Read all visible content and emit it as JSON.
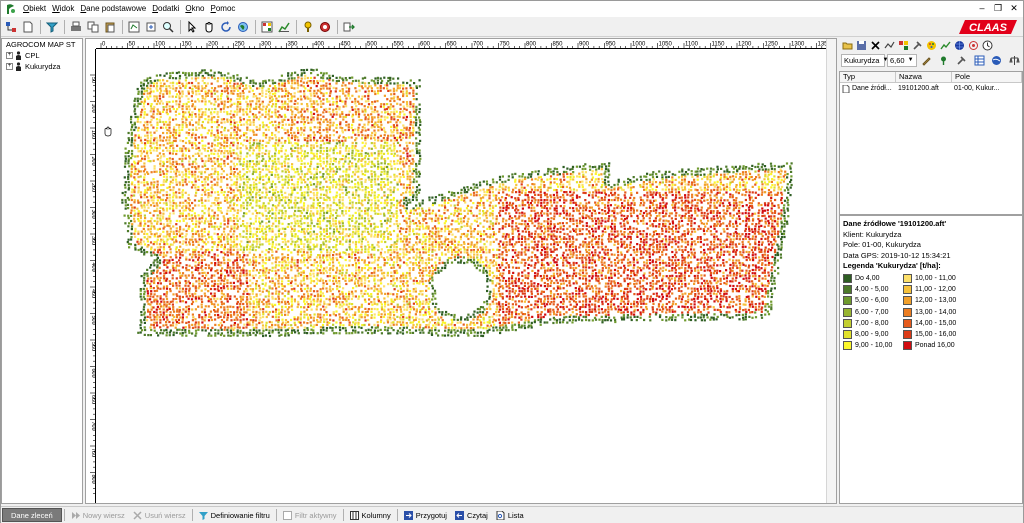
{
  "menu": {
    "items": [
      {
        "label": "Obiekt"
      },
      {
        "label": "Widok"
      },
      {
        "label": "Dane podstawowe"
      },
      {
        "label": "Dodatki"
      },
      {
        "label": "Okno"
      },
      {
        "label": "Pomoc"
      }
    ]
  },
  "brand": {
    "logo_text": "CLAAS",
    "logo_color": "#e2001a"
  },
  "tree": {
    "root": "AGROCOM MAP ST",
    "children": [
      {
        "label": "CPL"
      },
      {
        "label": "Kukurydza"
      }
    ]
  },
  "map": {
    "h_ticks": [
      "0",
      "50",
      "100",
      "150",
      "200",
      "250",
      "300",
      "350",
      "400",
      "450",
      "500",
      "550",
      "600",
      "650",
      "700",
      "750",
      "800",
      "850",
      "900",
      "950",
      "1000",
      "1050",
      "1100",
      "1150",
      "1200",
      "1250",
      "1300",
      "1350"
    ],
    "v_ticks": [
      "50",
      "100",
      "150",
      "200",
      "250",
      "300",
      "350",
      "400",
      "450",
      "500",
      "550",
      "600",
      "650",
      "700",
      "750",
      "800"
    ]
  },
  "right_panel": {
    "crop_select": "Kukurydza",
    "value_select": "6,60",
    "table": {
      "headers": [
        "Typ",
        "Nazwa",
        "Pole"
      ],
      "rows": [
        {
          "typ": "Dane źródł...",
          "nazwa": "19101200.aft",
          "pole": "01-00, Kukur..."
        }
      ]
    },
    "legend": {
      "title": "Dane źródłowe '19101200.aft'",
      "klient": "Klient: Kukurydza",
      "pole": "Pole: 01-00, Kukurydza",
      "data_gps": "Data GPS: 2019-10-12 15:34:21",
      "legend_title": "Legenda 'Kukurydza' [t/ha]:",
      "left_entries": [
        {
          "label": "Do 4,00",
          "color": "#2e5e23"
        },
        {
          "label": "4,00 - 5,00",
          "color": "#4d7a2a"
        },
        {
          "label": "5,00 - 6,00",
          "color": "#6f9a2e"
        },
        {
          "label": "6,00 - 7,00",
          "color": "#98b531"
        },
        {
          "label": "7,00 - 8,00",
          "color": "#c3cf30"
        },
        {
          "label": "8,00 - 9,00",
          "color": "#e2e22a"
        },
        {
          "label": "9,00 - 10,00",
          "color": "#fbf62a"
        }
      ],
      "right_entries": [
        {
          "label": "10,00 - 11,00",
          "color": "#fde06a"
        },
        {
          "label": "11,00 - 12,00",
          "color": "#f7c23a"
        },
        {
          "label": "12,00 - 13,00",
          "color": "#f2a02a"
        },
        {
          "label": "13,00 - 14,00",
          "color": "#ec7d21"
        },
        {
          "label": "14,00 - 15,00",
          "color": "#e55b1c"
        },
        {
          "label": "15,00 - 16,00",
          "color": "#dc3b17"
        },
        {
          "label": "Ponad 16,00",
          "color": "#d10c10"
        }
      ]
    }
  },
  "bottom_bar": {
    "dane_zlecen": "Dane zleceń",
    "nowy_wiersz": "Nowy wiersz",
    "usun_wiersz": "Usuń wiersz",
    "definiowanie_filtru": "Definiowanie filtru",
    "filtr_aktywny": "Filtr aktywny",
    "kolumny": "Kolumny",
    "przygotuj": "Przygotuj",
    "czytaj": "Czytaj",
    "lista": "Lista"
  }
}
